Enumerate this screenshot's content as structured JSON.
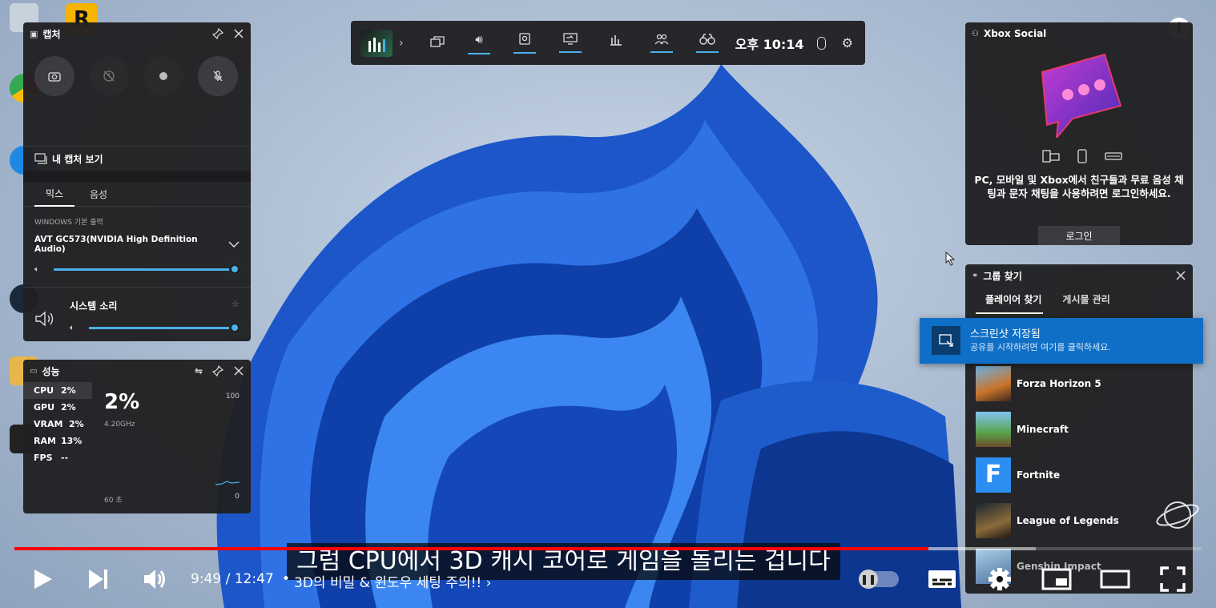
{
  "capture": {
    "title": "캡처",
    "view_captures": "내 캡처 보기",
    "tabs": [
      "믹스",
      "음성"
    ],
    "output_label": "WINDOWS 기본 출력",
    "device": "AVT GC573(NVIDIA High Definition Audio)",
    "device_level": 1.0,
    "app_name": "시스템 소리",
    "app_level": 1.0,
    "cut_item": "steam"
  },
  "perf": {
    "title": "성능",
    "metrics": [
      {
        "name": "CPU",
        "value": "2%"
      },
      {
        "name": "GPU",
        "value": "2%"
      },
      {
        "name": "VRAM",
        "value": "2%"
      },
      {
        "name": "RAM",
        "value": "13%"
      },
      {
        "name": "FPS",
        "value": "--"
      }
    ],
    "big_value": "2%",
    "freq": "4.20GHz",
    "max": "100",
    "time": "60 초",
    "min": "0"
  },
  "gamebar": {
    "time": "오후 10:14"
  },
  "social": {
    "title": "Xbox Social",
    "desc": "PC, 모바일 및 Xbox에서 친구들과 무료 음성 채팅과 문자 채팅을 사용하려면 로그인하세요.",
    "login": "로그인"
  },
  "lfg": {
    "title": "그룹 찾기",
    "tabs": [
      "플레이어 찾기",
      "게시물 관리"
    ],
    "games": [
      "Forza Horizon 5",
      "Minecraft",
      "Fortnite",
      "League of Legends",
      "Genshin Impact"
    ]
  },
  "toast": {
    "title": "스크린샷 저장됨",
    "body": "공유를 시작하려면 여기를 클릭하세요."
  },
  "player": {
    "subtitle": "그럼 CPU에서 3D 캐시 코어로 게임을 돌리는 겁니다",
    "time": "9:49 / 12:47",
    "bullet": "•",
    "chapter": "3D의 비밀 & 윈도우 세팅 주의!!",
    "progress": 0.77,
    "buffered": 0.86,
    "colors": {
      "played": "#ff0000",
      "buffered": "rgba(255,255,255,0.45)"
    }
  }
}
